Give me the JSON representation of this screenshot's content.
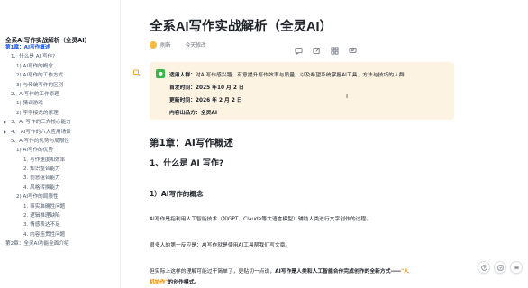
{
  "sidebar": {
    "title": "全系AI写作实战解析（全灵AI）",
    "items": [
      {
        "label": "第1章：AI写作概述",
        "level": 1,
        "active": true,
        "expandable": false
      },
      {
        "label": "1、什么是 AI 写作?",
        "level": 2,
        "active": false,
        "expandable": false
      },
      {
        "label": "1) AI写作的概念",
        "level": 3,
        "active": false,
        "expandable": false
      },
      {
        "label": "2) AI写作的工作方式",
        "level": 3,
        "active": false,
        "expandable": false
      },
      {
        "label": "3) 与传统写作的区别",
        "level": 3,
        "active": false,
        "expandable": false
      },
      {
        "label": "2、AI写作的工作原理",
        "level": 2,
        "active": false,
        "expandable": false
      },
      {
        "label": "1) 猜词游戏",
        "level": 3,
        "active": false,
        "expandable": false
      },
      {
        "label": "2) 字字接龙的原理",
        "level": 3,
        "active": false,
        "expandable": false
      },
      {
        "label": "3、AI 写作的三大核心能力",
        "level": 2,
        "active": false,
        "expandable": true
      },
      {
        "label": "4、 AI写作的六大应用场景",
        "level": 2,
        "active": false,
        "expandable": true
      },
      {
        "label": "5、AI写作的优势与局限性",
        "level": 2,
        "active": false,
        "expandable": false
      },
      {
        "label": "1) AI写作的优势",
        "level": 3,
        "active": false,
        "expandable": false
      },
      {
        "label": "1. 写作速度和效率",
        "level": 4,
        "active": false,
        "expandable": false
      },
      {
        "label": "2. 知识整合能力",
        "level": 4,
        "active": false,
        "expandable": false
      },
      {
        "label": "3. 创意组合能力",
        "level": 4,
        "active": false,
        "expandable": false
      },
      {
        "label": "4. 风格转换能力",
        "level": 4,
        "active": false,
        "expandable": false
      },
      {
        "label": "2) AI写作的局限性",
        "level": 3,
        "active": false,
        "expandable": false
      },
      {
        "label": "1. 事实准确性问题",
        "level": 4,
        "active": false,
        "expandable": false
      },
      {
        "label": "2. 逻辑推理缺陷",
        "level": 4,
        "active": false,
        "expandable": false
      },
      {
        "label": "3. 情感表达不足",
        "level": 4,
        "active": false,
        "expandable": false
      },
      {
        "label": "4. 内容连贯性问题",
        "level": 4,
        "active": false,
        "expandable": false
      },
      {
        "label": "第2章：全灵AI功能全面介绍",
        "level": 1,
        "active": false,
        "expandable": false
      }
    ]
  },
  "doc": {
    "title": "全系AI写作实战解析（全灵AI）",
    "author": "刷新",
    "modified": "今天修改"
  },
  "callout": {
    "audience_label": "适用人群：",
    "audience_text": "对AI写作感兴趣、有意提升写作效率与质量，以及希望系统掌握AI工具、方法与技巧的人群",
    "first_label": "首发时间：",
    "first_value": "2025 年10 月 2 日",
    "updated_label": "更新时间：",
    "updated_value": "2026 年 2 月 2 日",
    "source_label": "内容出品方：",
    "source_value": "全灵AI"
  },
  "content": {
    "chapter": "第1章：AI写作概述",
    "section": "1、什么是 AI 写作?",
    "subsection": "1）AI写作的概念",
    "p1": "AI写作是指利用人工智能技术（如GPT、Claude等大语言模型）辅助人类进行文字创作的过程。",
    "p2": "很多人的第一反应是：AI写作就是使用AI工具帮我们写文章。",
    "p3_a": "但实际上这样的理解可能过于简单了，更贴切一点说，",
    "p3_b": "AI写作是人类和人工智能合作完成创作的全新方式——",
    "p3_c": "\"人",
    "p4_a": "机协作\"",
    "p4_b": "的创作模式。"
  },
  "icons": {
    "toolbar": [
      "comment-icon",
      "edit-icon",
      "grid-icon",
      "chat-icon"
    ],
    "callout": "bulb-icon",
    "float": [
      "help-icon",
      "feedback-icon",
      "menu-icon"
    ]
  },
  "colors": {
    "accent": "#1456f0",
    "callout_bg": "#fdf3e2",
    "highlight": "#f08c00",
    "callout_icon": "#39b54a"
  }
}
